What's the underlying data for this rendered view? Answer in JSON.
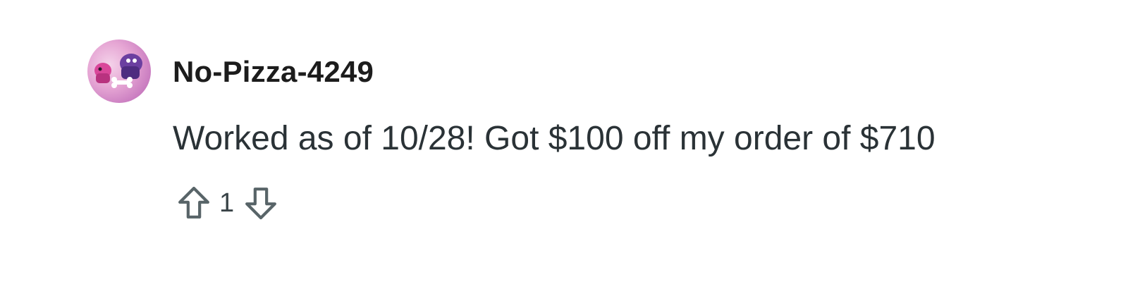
{
  "comment": {
    "author": "No-Pizza-4249",
    "body": "Worked as of 10/28! Got $100 off my order of $710",
    "score": "1",
    "avatar": {
      "icon": "user-avatar",
      "colors": [
        "#e6a6d4",
        "#6b3fa0",
        "#ffffff"
      ]
    },
    "actions": {
      "upvote_icon": "arrow-up-icon",
      "downvote_icon": "arrow-down-icon"
    }
  },
  "colors": {
    "username": "#1c1c1c",
    "body_text": "#2a3236",
    "icon_stroke": "#586468"
  }
}
